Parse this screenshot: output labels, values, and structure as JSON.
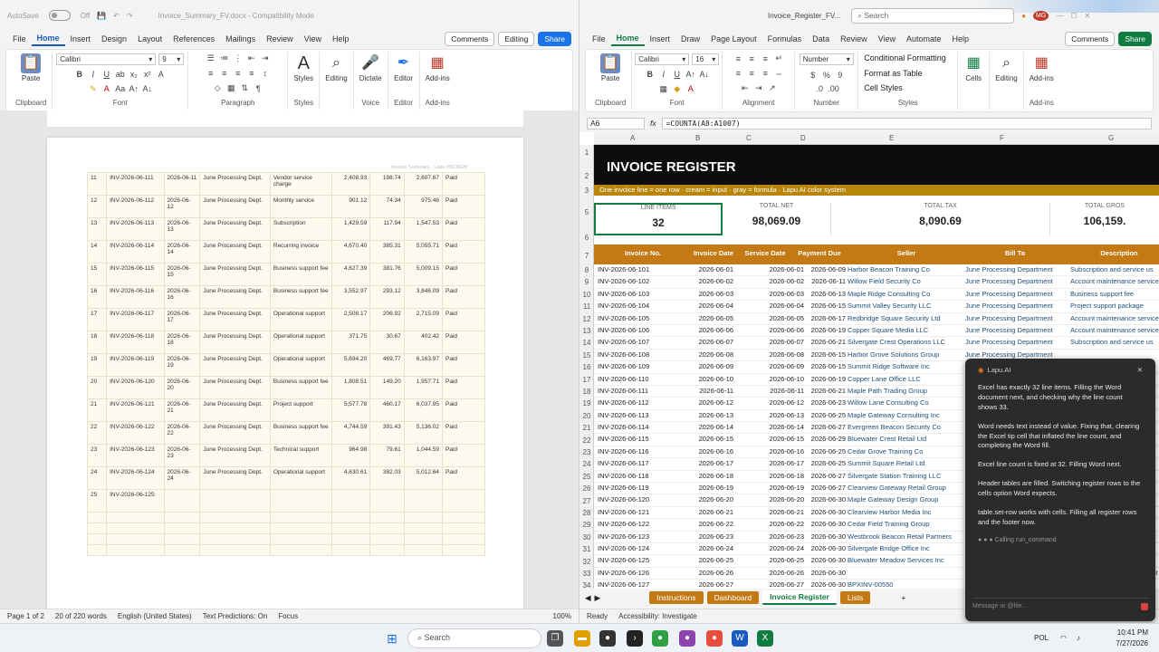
{
  "word": {
    "autosave_label": "AutoSave",
    "autosave_state": "Off",
    "doc_title": "Invoice_Summary_FV.docx - Compatibility Mode",
    "tabs": [
      "File",
      "Home",
      "Insert",
      "Design",
      "Layout",
      "References",
      "Mailings",
      "Review",
      "View",
      "Help"
    ],
    "active_tab": "Home",
    "comments_label": "Comments",
    "editing_label": "Editing",
    "share_label": "Share",
    "font_name": "Calibri",
    "font_size": "9",
    "groups": {
      "clipboard": "Clipboard",
      "font": "Font",
      "paragraph": "Paragraph",
      "styles": "Styles",
      "voice": "Voice",
      "editor": "Editor"
    },
    "buttons": {
      "paste": "Paste",
      "styles": "Styles",
      "editing": "Editing",
      "dictate": "Dictate",
      "editor": "Editor",
      "addins": "Add-ins"
    },
    "doc_tag": "Invoice Summary  ·  Lapu #BC8028",
    "table_rows": [
      [
        "11",
        "INV-2026-06-111",
        "2026-06-11",
        "June Processing Dept.",
        "Vendor service charge",
        "2,408.93",
        "198.74",
        "2,607.67",
        "Paid"
      ],
      [
        "12",
        "INV-2026-06-112",
        "2026-06-12",
        "June Processing Dept.",
        "Monthly service",
        "901.12",
        "74.34",
        "975.46",
        "Paid"
      ],
      [
        "13",
        "INV-2026-06-113",
        "2026-06-13",
        "June Processing Dept.",
        "Subscription",
        "1,429.59",
        "117.94",
        "1,547.53",
        "Paid"
      ],
      [
        "14",
        "INV-2026-06-114",
        "2026-06-14",
        "June Processing Dept.",
        "Recurring invoice",
        "4,670.40",
        "385.31",
        "5,055.71",
        "Paid"
      ],
      [
        "15",
        "INV-2026-06-115",
        "2026-06-15",
        "June Processing Dept.",
        "Business support fee",
        "4,627.39",
        "381.76",
        "5,009.15",
        "Paid"
      ],
      [
        "16",
        "INV-2026-06-116",
        "2026-06-16",
        "June Processing Dept.",
        "Business support fee",
        "3,552.97",
        "293.12",
        "3,846.09",
        "Paid"
      ],
      [
        "17",
        "INV-2026-06-117",
        "2026-06-17",
        "June Processing Dept.",
        "Operational support",
        "2,508.17",
        "206.92",
        "2,715.09",
        "Paid"
      ],
      [
        "18",
        "INV-2026-06-118",
        "2026-06-18",
        "June Processing Dept.",
        "Operational support",
        "371.75",
        "30.67",
        "402.42",
        "Paid"
      ],
      [
        "19",
        "INV-2026-06-119",
        "2026-06-19",
        "June Processing Dept.",
        "Operational support",
        "5,694.20",
        "469.77",
        "6,163.97",
        "Paid"
      ],
      [
        "20",
        "INV-2026-06-120",
        "2026-06-20",
        "June Processing Dept.",
        "Business support fee",
        "1,808.51",
        "149.20",
        "1,957.71",
        "Paid"
      ],
      [
        "21",
        "INV-2026-06-121",
        "2026-06-21",
        "June Processing Dept.",
        "Project support",
        "5,577.78",
        "460.17",
        "6,037.95",
        "Paid"
      ],
      [
        "22",
        "INV-2026-06-122",
        "2026-06-22",
        "June Processing Dept.",
        "Business support fee",
        "4,744.59",
        "391.43",
        "5,136.02",
        "Paid"
      ],
      [
        "23",
        "INV-2026-06-123",
        "2026-06-23",
        "June Processing Dept.",
        "Technical support",
        "964.98",
        "79.61",
        "1,044.59",
        "Paid"
      ],
      [
        "24",
        "INV-2026-06-124",
        "2026-06-24",
        "June Processing Dept.",
        "Operational support",
        "4,630.61",
        "382.03",
        "5,012.64",
        "Paid"
      ],
      [
        "25",
        "INV-2026-06-125",
        "",
        "",
        "",
        "",
        "",
        "",
        ""
      ]
    ],
    "status": {
      "page": "Page 1 of 2",
      "words": "20 of 220 words",
      "language": "English (United States)",
      "predictions": "Text Predictions: On",
      "focus": "Focus",
      "zoom": "100%"
    }
  },
  "excel": {
    "doc_title": "Invoice_Register_FV...",
    "search_placeholder": "Search",
    "avatar": "MG",
    "tabs": [
      "File",
      "Home",
      "Insert",
      "Draw",
      "Page Layout",
      "Formulas",
      "Data",
      "Review",
      "View",
      "Automate",
      "Help"
    ],
    "active_tab": "Home",
    "comments_label": "Comments",
    "share_label": "Share",
    "font_name": "Calibri",
    "font_size": "16",
    "number_format": "Number",
    "styles_items": [
      "Conditional Formatting",
      "Format as Table",
      "Cell Styles"
    ],
    "groups": {
      "clipboard": "Clipboard",
      "font": "Font",
      "alignment": "Alignment",
      "number": "Number",
      "styles": "Styles"
    },
    "buttons": {
      "paste": "Paste",
      "cells": "Cells",
      "editing": "Editing",
      "addins": "Add-ins"
    },
    "name_box": "A6",
    "formula": "=COUNTA(A8:A1007)",
    "columns": [
      "A",
      "B",
      "C",
      "D",
      "E",
      "F",
      "G"
    ],
    "row_numbers": [
      "1",
      "2",
      "3",
      "5",
      "6",
      "7",
      "8",
      "9",
      "10",
      "11",
      "12",
      "13",
      "14",
      "15",
      "16",
      "17",
      "18",
      "19",
      "20",
      "21",
      "22",
      "23",
      "24",
      "25",
      "26",
      "27",
      "28",
      "29",
      "30",
      "31",
      "32",
      "33",
      "34"
    ],
    "banner_title": "INVOICE REGISTER",
    "banner_subtitle": "One invoice line = one row  ·  cream = input  ·  gray = formula  ·  Lapu AI color system",
    "kpis": [
      {
        "label": "LINE ITEMS",
        "value": "32"
      },
      {
        "label": "TOTAL NET",
        "value": "98,069.09"
      },
      {
        "label": "TOTAL TAX",
        "value": "8,090.69"
      },
      {
        "label": "TOTAL GROS",
        "value": "106,159."
      }
    ],
    "headers": [
      "Invoice No.",
      "Invoice Date",
      "Service Date",
      "Payment Due",
      "Seller",
      "Bill To",
      "Description"
    ],
    "rows": [
      [
        "INV-2026-06-101",
        "2026-06-01",
        "2026-06-01",
        "2026-06-09",
        "Harbor Beacon Training Co",
        "June Processing Department",
        "Subscription and service us"
      ],
      [
        "INV-2026-06-102",
        "2026-06-02",
        "2026-06-02",
        "2026-06-11",
        "Willow Field Security Co",
        "June Processing Department",
        "Account maintenance service"
      ],
      [
        "INV-2026-06-103",
        "2026-06-03",
        "2026-06-03",
        "2026-06-13",
        "Maple Ridge Consulting Co",
        "June Processing Department",
        "Business support fee"
      ],
      [
        "INV-2026-06-104",
        "2026-06-04",
        "2026-06-04",
        "2026-06-15",
        "Summit Valley Security LLC",
        "June Processing Department",
        "Project support package"
      ],
      [
        "INV-2026-06-105",
        "2026-06-05",
        "2026-06-05",
        "2026-06-17",
        "Redbridge Square Security Ltd",
        "June Processing Department",
        "Account maintenance service"
      ],
      [
        "INV-2026-06-106",
        "2026-06-06",
        "2026-06-06",
        "2026-06-19",
        "Copper Square Media LLC",
        "June Processing Department",
        "Account maintenance service"
      ],
      [
        "INV-2026-06-107",
        "2026-06-07",
        "2026-06-07",
        "2026-06-21",
        "Silvergate Crest Operations LLC",
        "June Processing Department",
        "Subscription and service us"
      ],
      [
        "INV-2026-06-108",
        "2026-06-08",
        "2026-06-08",
        "2026-06-15",
        "Harbor Grove Solutions Group",
        "June Processing Department",
        ""
      ],
      [
        "INV-2026-06-109",
        "2026-06-09",
        "2026-06-09",
        "2026-06-15",
        "Summit Ridge Software Inc",
        "June Processing Department",
        ""
      ],
      [
        "INV-2026-06-110",
        "2026-06-10",
        "2026-06-10",
        "2026-06-19",
        "Copper Lane Office LLC",
        "June Processing Department",
        ""
      ],
      [
        "INV-2026-06-111",
        "2026-06-11",
        "2026-06-11",
        "2026-06-21",
        "Maple Path Trading Group",
        "June Processing Department",
        ""
      ],
      [
        "INV-2026-06-112",
        "2026-06-12",
        "2026-06-12",
        "2026-06-23",
        "Willow Lane Consulting Co",
        "June Processing Department",
        ""
      ],
      [
        "INV-2026-06-113",
        "2026-06-13",
        "2026-06-13",
        "2026-06-25",
        "Maple Gateway Consulting Inc",
        "June Processing Department",
        ""
      ],
      [
        "INV-2026-06-114",
        "2026-06-14",
        "2026-06-14",
        "2026-06-27",
        "Evergreen Beacon Security Co",
        "June Processing Department",
        ""
      ],
      [
        "INV-2026-06-115",
        "2026-06-15",
        "2026-06-15",
        "2026-06-29",
        "Bluewater Crest Retail Ltd",
        "June Processing Department",
        ""
      ],
      [
        "INV-2026-06-116",
        "2026-06-16",
        "2026-06-16",
        "2026-06-25",
        "Cedar Grove Training Co",
        "June Processing Department",
        ""
      ],
      [
        "INV-2026-06-117",
        "2026-06-17",
        "2026-06-17",
        "2026-06-25",
        "Summit Square Retail Ltd",
        "June Processing Department",
        ""
      ],
      [
        "INV-2026-06-118",
        "2026-06-18",
        "2026-06-18",
        "2026-06-27",
        "Silvergate Station Training LLC",
        "June Processing Department",
        ""
      ],
      [
        "INV-2026-06-119",
        "2026-06-19",
        "2026-06-19",
        "2026-06-27",
        "Clearview Gateway Retail Group",
        "June Processing Department",
        ""
      ],
      [
        "INV-2026-06-120",
        "2026-06-20",
        "2026-06-20",
        "2026-06-30",
        "Maple Gateway Design Group",
        "June Processing Department",
        ""
      ],
      [
        "INV-2026-06-121",
        "2026-06-21",
        "2026-06-21",
        "2026-06-30",
        "Clearview Harbor Media Inc",
        "June Processing Department",
        ""
      ],
      [
        "INV-2026-06-122",
        "2026-06-22",
        "2026-06-22",
        "2026-06-30",
        "Cedar Field Training Group",
        "June Processing Department",
        ""
      ],
      [
        "INV-2026-06-123",
        "2026-06-23",
        "2026-06-23",
        "2026-06-30",
        "Westbrook Beacon Retail Partners",
        "June Processing Department",
        ""
      ],
      [
        "INV-2026-06-124",
        "2026-06-24",
        "2026-06-24",
        "2026-06-30",
        "Silvergate Bridge Office Inc",
        "June Processing Department",
        ""
      ],
      [
        "INV-2026-06-125",
        "2026-06-25",
        "2026-06-25",
        "2026-06-30",
        "Bluewater Meadow Services Inc",
        "June Processing Department",
        ""
      ],
      [
        "INV-2026-06-126",
        "2026-06-26",
        "2026-06-26",
        "2026-06-30",
        "",
        "12820",
        "June Processing Department"
      ],
      [
        "INV-2026-06-127",
        "2026-06-27",
        "2026-06-27",
        "2026-06-30",
        "BPXINV-00550",
        "",
        ""
      ]
    ],
    "sheet_tabs": [
      "Instructions",
      "Dashboard",
      "Invoice Register",
      "Lists"
    ],
    "active_sheet": "Invoice Register",
    "status": {
      "ready": "Ready",
      "accessibility": "Accessibility: Investigate"
    }
  },
  "chat": {
    "title": "Lapu.AI",
    "messages": [
      "Excel has exactly 32 line items. Filling the Word document next, and checking why the line count shows 33.",
      "Word needs text instead of value. Fixing that, clearing the Excel tip cell that inflated the line count, and completing the Word fill.",
      "Excel line count is fixed at 32. Filling Word next.",
      "Header tables are filled. Switching register rows to the cells option Word expects.",
      "table.set-row works with cells. Filling all register rows and the footer now."
    ],
    "status": "Calling run_command",
    "input_placeholder": "Message or @file..."
  },
  "taskbar": {
    "search": "Search",
    "lang": "POL",
    "time": "10:41 PM",
    "date": "7/27/2026"
  }
}
